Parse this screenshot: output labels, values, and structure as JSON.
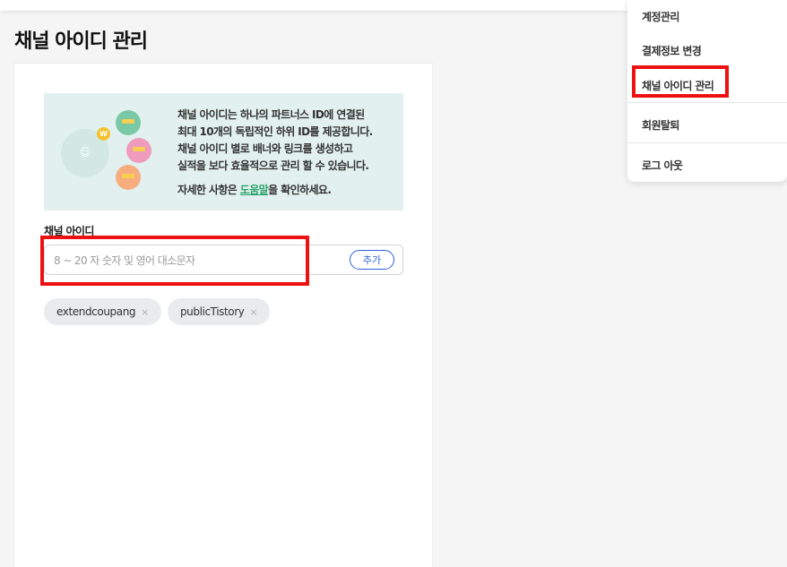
{
  "page": {
    "title": "채널 아이디 관리"
  },
  "banner": {
    "lines": [
      "채널 아이디는 하나의 파트너스 ID에 연결된",
      "최대 10개의 독립적인 하위 ID를 제공합니다.",
      "채널 아이디 별로 배너와 링크를 생성하고",
      "실적을 보다 효율적으로 관리 할 수 있습니다."
    ],
    "help_prefix": "자세한 사항은 ",
    "help_link": "도움말",
    "help_suffix": "을 확인하세요.",
    "badge_letter": "W"
  },
  "channel_form": {
    "label": "채널 아이디",
    "placeholder": "8 ~ 20 자 숫자 및 영어 대소문자",
    "value": "",
    "add_label": "추가"
  },
  "tags": [
    {
      "label": "extendcoupang",
      "remove": "×"
    },
    {
      "label": "publicTistory",
      "remove": "×"
    }
  ],
  "menu": {
    "items": [
      "계정관리",
      "결제정보 변경",
      "채널 아이디 관리",
      "회원탈퇴",
      "로그 아웃"
    ]
  },
  "colors": {
    "highlight_red": "#ee1111",
    "accent_blue": "#2e5fd9",
    "help_green": "#2aa36a",
    "banner_bg": "#e2f1ef"
  }
}
